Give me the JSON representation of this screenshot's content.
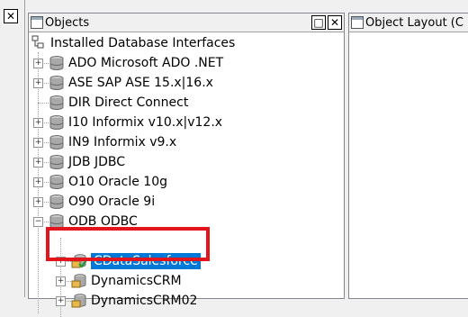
{
  "objects_panel": {
    "title": "Objects",
    "title_icon": "objects-window-icon",
    "buttons": {
      "restore": "□",
      "close": "✕"
    }
  },
  "layout_panel": {
    "title": "Object Layout (C",
    "title_icon": "layout-window-icon"
  },
  "left_strip": {
    "close": "✕"
  },
  "tree": {
    "root_label": "Installed Database Interfaces",
    "interfaces": [
      {
        "label": "ADO Microsoft ADO .NET",
        "expander": "+"
      },
      {
        "label": "ASE SAP ASE 15.x|16.x",
        "expander": "+"
      },
      {
        "label": "DIR Direct Connect",
        "expander": ""
      },
      {
        "label": "I10 Informix v10.x|v12.x",
        "expander": "+"
      },
      {
        "label": "IN9 Informix v9.x",
        "expander": "+"
      },
      {
        "label": "JDB JDBC",
        "expander": "+"
      },
      {
        "label": "O10 Oracle 10g",
        "expander": "+"
      },
      {
        "label": "O90 Oracle 9i",
        "expander": "+"
      },
      {
        "label": "ODB ODBC",
        "expander": "−"
      }
    ],
    "odbc_children": [
      {
        "label": "CDataSalesforce",
        "expander": "+",
        "selected": true
      },
      {
        "label": "DynamicsCRM",
        "expander": "+",
        "selected": false
      },
      {
        "label": "DynamicsCRM02",
        "expander": "+",
        "selected": false
      }
    ]
  },
  "colors": {
    "selection": "#0078d7",
    "highlight_border": "#e3141b",
    "db_icon": "#8c8c8c",
    "folder": "#e8b84a"
  }
}
